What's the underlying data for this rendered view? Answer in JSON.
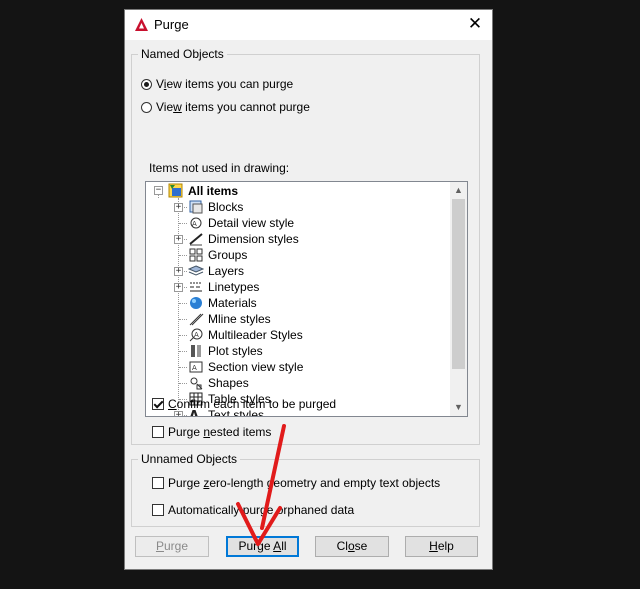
{
  "window": {
    "title": "Purge",
    "close_glyph": "✕"
  },
  "named_objects": {
    "legend": "Named Objects",
    "radio_can": {
      "pre": "V",
      "hot": "i",
      "post": "ew items you can purge",
      "selected": true
    },
    "radio_cannot": {
      "pre": "Vie",
      "hot": "w",
      "post": " items you cannot purge",
      "selected": false
    },
    "tree_label": "Items not used in drawing:",
    "tree": {
      "root": {
        "label": "All items",
        "icon": "all-items-icon"
      },
      "items": [
        {
          "label": "Blocks",
          "icon": "blocks-icon",
          "expandable": true
        },
        {
          "label": "Detail view style",
          "icon": "detail-view-style-icon",
          "expandable": false
        },
        {
          "label": "Dimension styles",
          "icon": "dimension-styles-icon",
          "expandable": true
        },
        {
          "label": "Groups",
          "icon": "groups-icon",
          "expandable": false
        },
        {
          "label": "Layers",
          "icon": "layers-icon",
          "expandable": true
        },
        {
          "label": "Linetypes",
          "icon": "linetypes-icon",
          "expandable": true
        },
        {
          "label": "Materials",
          "icon": "materials-icon",
          "expandable": false
        },
        {
          "label": "Mline styles",
          "icon": "mline-styles-icon",
          "expandable": false
        },
        {
          "label": "Multileader Styles",
          "icon": "multileader-styles-icon",
          "expandable": false
        },
        {
          "label": "Plot styles",
          "icon": "plot-styles-icon",
          "expandable": false
        },
        {
          "label": "Section view style",
          "icon": "section-view-style-icon",
          "expandable": false
        },
        {
          "label": "Shapes",
          "icon": "shapes-icon",
          "expandable": false
        },
        {
          "label": "Table styles",
          "icon": "table-styles-icon",
          "expandable": false
        },
        {
          "label": "Text styles",
          "icon": "text-styles-icon",
          "expandable": true
        }
      ]
    },
    "confirm": {
      "pre": "",
      "hot": "C",
      "post": "onfirm each item to be purged",
      "checked": true
    },
    "nested": {
      "pre": "Purge ",
      "hot": "n",
      "post": "ested items",
      "checked": false
    }
  },
  "unnamed_objects": {
    "legend": "Unnamed Objects",
    "zero_length": {
      "pre": "Purge ",
      "hot": "z",
      "post": "ero-length geometry and empty text objects",
      "checked": false
    },
    "orphaned": {
      "pre": "Automatically purge orphaned data",
      "checked": false
    }
  },
  "buttons": {
    "purge": {
      "pre": "",
      "hot": "P",
      "post": "urge",
      "disabled": true
    },
    "purge_all": {
      "pre": "Purge ",
      "hot": "A",
      "post": "ll",
      "focused": true
    },
    "close": {
      "pre": "Cl",
      "hot": "o",
      "post": "se"
    },
    "help": {
      "pre": "",
      "hot": "H",
      "post": "elp"
    }
  },
  "colors": {
    "accent": "#0078d7",
    "annotation_arrow": "#e11b1b",
    "app_icon": "#c8102e"
  }
}
